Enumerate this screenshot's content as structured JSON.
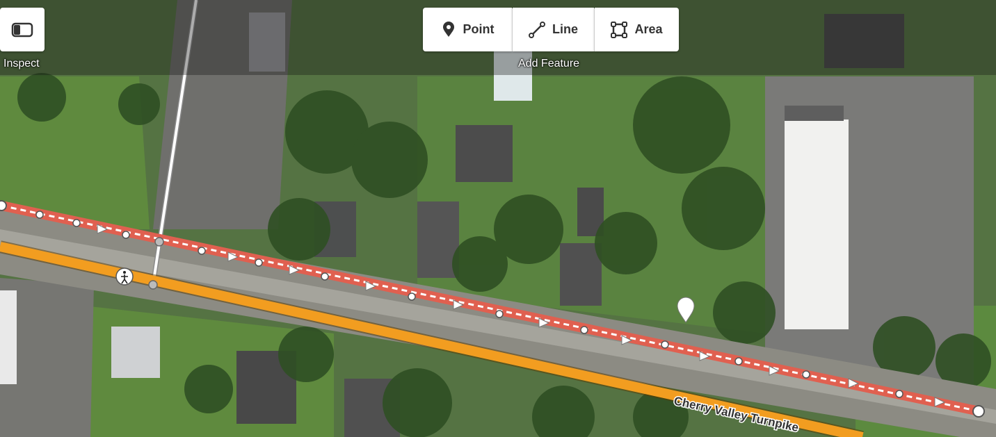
{
  "toolbar": {
    "inspect_label": "Inspect",
    "add_feature_label": "Add Feature",
    "point_label": "Point",
    "line_label": "Line",
    "area_label": "Area"
  },
  "map": {
    "road_name": "Cherry Valley Turnpike",
    "colors": {
      "main_road": "#f29d20",
      "rail_line": "#e06050",
      "footway": "#ffffff",
      "accent": "#333333"
    }
  }
}
